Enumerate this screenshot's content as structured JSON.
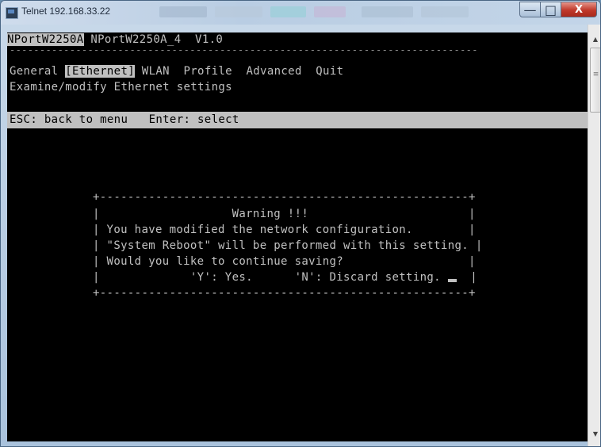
{
  "window": {
    "title": "Telnet 192.168.33.22",
    "minimize": "—",
    "maximize": "□",
    "close": "X"
  },
  "terminal": {
    "header": {
      "device": "NPortW2250A",
      "rest": " NPortW2250A_4  V1.0"
    },
    "divider": "------------------------------------------------------------------------------",
    "menu": {
      "pre": "General ",
      "selected": "[Ethernet]",
      "post": " WLAN  Profile  Advanced  Quit"
    },
    "description": "Examine/modify Ethernet settings",
    "status_line": "ESC: back to menu   Enter: select",
    "dialog": {
      "top": "+-----------------------------------------------------+",
      "line1": "|                   Warning !!!                       |",
      "line2": "| You have modified the network configuration.        |",
      "line3": "| \"System Reboot\" will be performed with this setting. |",
      "line4": "| Would you like to continue saving?                  |",
      "line5": "|             'Y': Yes.      'N': Discard setting. ",
      "line5_end": "  |",
      "bottom": "+-----------------------------------------------------+"
    }
  },
  "scrollbar": {
    "up": "▲",
    "down": "▼"
  },
  "colors": {
    "terminal_bg": "#000000",
    "terminal_fg": "#c0c0c0",
    "close_button": "#c0392b"
  }
}
